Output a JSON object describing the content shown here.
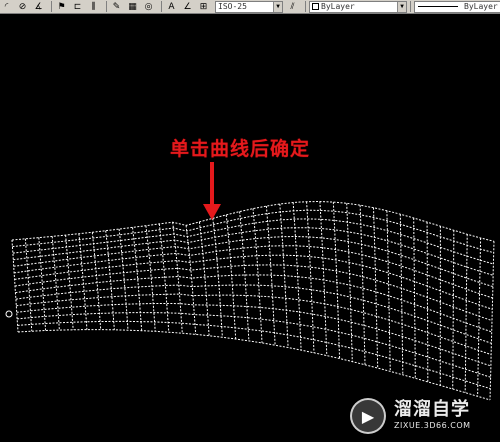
{
  "toolbar": {
    "dimstyle_value": "ISO-25",
    "layer_color_value": "ByLayer",
    "linetype_value": "ByLayer",
    "icons": [
      "arc-icon",
      "no-icon",
      "angle-icon",
      "flag-icon",
      "layout-icon",
      "chart-icon",
      "wrench-icon",
      "grid-icon",
      "target-icon",
      "text-icon",
      "angle-dim-icon",
      "ruler-icon",
      "brush-icon"
    ]
  },
  "canvas": {
    "background_color": "#000000",
    "mesh_color": "#ffffff",
    "annotation_text": "单击曲线后确定",
    "annotation_color": "#e4191c"
  },
  "watermark": {
    "brand_text": "溜溜自学",
    "url_text": "ZIXUE.3D66.COM"
  }
}
